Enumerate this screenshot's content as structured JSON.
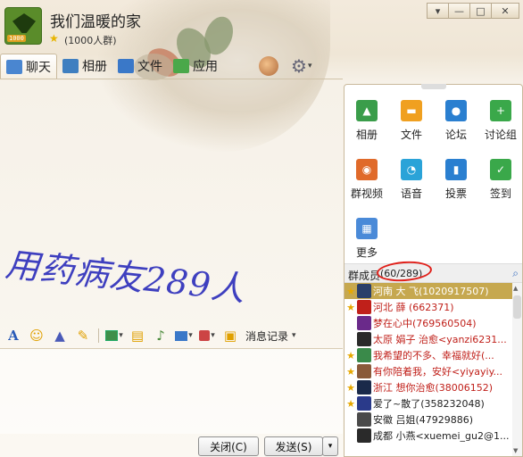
{
  "window": {
    "group_name": "我们温暖的家",
    "group_size": "(1000人群)",
    "logo_badge": "1000",
    "controls": [
      "▾",
      "—",
      "□",
      "✕"
    ]
  },
  "tabs": [
    {
      "label": "聊天",
      "icon": "chat-icon",
      "color": "#4a86d0"
    },
    {
      "label": "相册",
      "icon": "album-icon",
      "color": "#3f7fc0"
    },
    {
      "label": "文件",
      "icon": "file-icon",
      "color": "#3a78c8"
    },
    {
      "label": "应用",
      "icon": "apps-icon",
      "color": "#4aa84a"
    }
  ],
  "chat": {
    "watermark_text": "用药病友289人"
  },
  "toolbar": {
    "history_label": "消息记录"
  },
  "buttons": {
    "close": "关闭(C)",
    "send": "发送(S)"
  },
  "apps": [
    {
      "label": "相册",
      "icon": "photo-icon",
      "color": "#3a9d4a"
    },
    {
      "label": "文件",
      "icon": "folder-icon",
      "color": "#f0a020"
    },
    {
      "label": "论坛",
      "icon": "forum-icon",
      "color": "#2a7fd0"
    },
    {
      "label": "讨论组",
      "icon": "discussion-icon",
      "color": "#3aa84a"
    },
    {
      "label": "群视频",
      "icon": "video-icon",
      "color": "#e06a2a"
    },
    {
      "label": "语音",
      "icon": "voice-icon",
      "color": "#2aa3d8"
    },
    {
      "label": "投票",
      "icon": "vote-icon",
      "color": "#2a7fd0"
    },
    {
      "label": "签到",
      "icon": "checkin-icon",
      "color": "#3aa84a"
    },
    {
      "label": "更多",
      "icon": "more-icon",
      "color": "#4a8ad8"
    }
  ],
  "members": {
    "title": "群成员",
    "count": "(60/289)",
    "list": [
      {
        "name": "河南 大 飞(1020917507)",
        "star": true,
        "selected": true,
        "color": "#ffffff"
      },
      {
        "name": "河北 薛 (662371)",
        "star": true,
        "selected": false,
        "color": "#c0201a"
      },
      {
        "name": "梦在心中(769560504)",
        "star": false,
        "selected": false,
        "color": "#c0201a"
      },
      {
        "name": "太原 娟子 治愈<yanzi6231...",
        "star": false,
        "selected": false,
        "color": "#c0201a"
      },
      {
        "name": "我希望的不多、幸福就好(...",
        "star": true,
        "selected": false,
        "color": "#c0201a"
      },
      {
        "name": "有你陪着我，安好<yiyayiy...",
        "star": true,
        "selected": false,
        "color": "#c0201a"
      },
      {
        "name": "浙江 想你治愈(38006152)",
        "star": true,
        "selected": false,
        "color": "#c0201a"
      },
      {
        "name": "爱了~散了(358232048)",
        "star": true,
        "selected": false,
        "color": "#222222"
      },
      {
        "name": "安徽 吕姐(47929886)",
        "star": false,
        "selected": false,
        "color": "#222222"
      },
      {
        "name": "成都 小燕<xuemei_gu2@1...",
        "star": false,
        "selected": false,
        "color": "#222222"
      }
    ]
  }
}
